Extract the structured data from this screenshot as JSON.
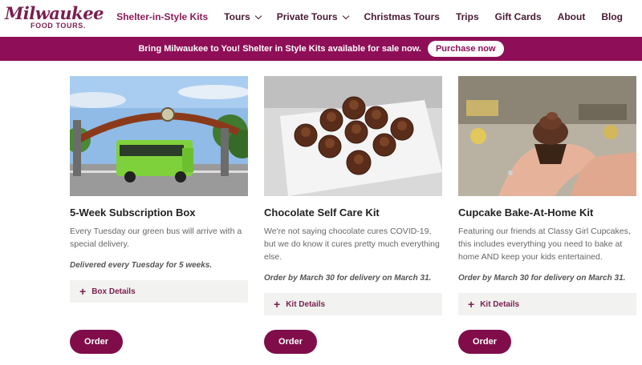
{
  "brand": {
    "logo_main": "Milwaukee",
    "logo_sub": "FOOD TOURS."
  },
  "nav": {
    "items": [
      {
        "label": "Shelter-in-Style Kits",
        "has_dropdown": false,
        "active": true
      },
      {
        "label": "Tours",
        "has_dropdown": true,
        "active": false
      },
      {
        "label": "Private Tours",
        "has_dropdown": true,
        "active": false
      },
      {
        "label": "Christmas Tours",
        "has_dropdown": false,
        "active": false
      },
      {
        "label": "Trips",
        "has_dropdown": false,
        "active": false
      },
      {
        "label": "Gift Cards",
        "has_dropdown": false,
        "active": false
      },
      {
        "label": "About",
        "has_dropdown": false,
        "active": false
      },
      {
        "label": "Blog",
        "has_dropdown": false,
        "active": false
      }
    ]
  },
  "banner": {
    "text": "Bring Milwaukee to You! Shelter in Style Kits available for sale now.",
    "button_label": "Purchase now"
  },
  "cards": [
    {
      "title": "5-Week Subscription Box",
      "description": "Every Tuesday our green bus will arrive with a special delivery.",
      "note": "Delivered every Tuesday for 5 weeks.",
      "details_label": "Box Details",
      "order_label": "Order"
    },
    {
      "title": "Chocolate Self Care Kit",
      "description": "We're not saying chocolate cures COVID-19, but we do know it cures pretty much everything else.",
      "note": "Order by March 30 for delivery on March 31.",
      "details_label": "Kit Details",
      "order_label": "Order"
    },
    {
      "title": "Cupcake Bake-At-Home Kit",
      "description": "Featuring our friends at Classy Girl Cupcakes, this includes everything you need to bake at home AND keep your kids entertained.",
      "note": "Order by March 30 for delivery on March 31.",
      "details_label": "Kit Details",
      "order_label": "Order"
    }
  ],
  "colors": {
    "brand": "#8e0f57",
    "nav_text": "#4a1a33",
    "button": "#800d4a",
    "details_bg": "#f2f2f0"
  }
}
